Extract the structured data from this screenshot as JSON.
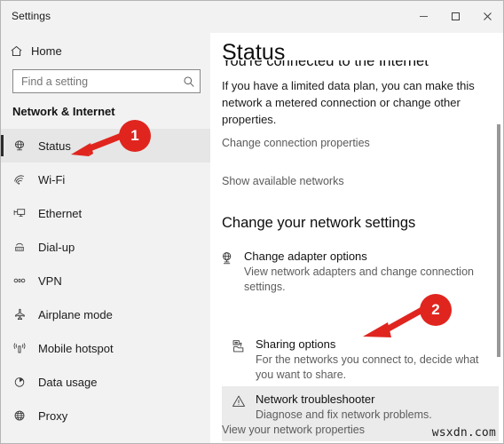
{
  "window": {
    "title": "Settings",
    "controls": {
      "minimize": "minimize-button",
      "maximize": "maximize-button",
      "close": "close-button"
    }
  },
  "sidebar": {
    "home_label": "Home",
    "home_icon": "home-icon",
    "search": {
      "placeholder": "Find a setting",
      "value": "",
      "icon": "search-icon"
    },
    "section_title": "Network & Internet",
    "items": [
      {
        "label": "Status",
        "icon": "status-globe-icon",
        "selected": true
      },
      {
        "label": "Wi-Fi",
        "icon": "wifi-icon",
        "selected": false
      },
      {
        "label": "Ethernet",
        "icon": "ethernet-icon",
        "selected": false
      },
      {
        "label": "Dial-up",
        "icon": "dialup-icon",
        "selected": false
      },
      {
        "label": "VPN",
        "icon": "vpn-icon",
        "selected": false
      },
      {
        "label": "Airplane mode",
        "icon": "airplane-icon",
        "selected": false
      },
      {
        "label": "Mobile hotspot",
        "icon": "hotspot-icon",
        "selected": false
      },
      {
        "label": "Data usage",
        "icon": "data-usage-pie-icon",
        "selected": false
      },
      {
        "label": "Proxy",
        "icon": "proxy-globe-icon",
        "selected": false
      }
    ]
  },
  "content": {
    "page_title": "Status",
    "clipped_heading": "You're connected to the Internet",
    "paragraph": "If you have a limited data plan, you can make this network a metered connection or change other properties.",
    "link_change_connection": "Change connection properties",
    "link_show_networks": "Show available networks",
    "group_heading": "Change your network settings",
    "options": [
      {
        "title": "Change adapter options",
        "subtitle": "View network adapters and change connection settings.",
        "icon": "network-adapter-icon",
        "highlighted": false
      },
      {
        "title": "Sharing options",
        "subtitle": "For the networks you connect to, decide what you want to share.",
        "icon": "sharing-folder-icon",
        "highlighted": true
      },
      {
        "title": "Network troubleshooter",
        "subtitle": "Diagnose and fix network problems.",
        "icon": "warning-triangle-icon",
        "highlighted": false
      }
    ],
    "link_view_properties": "View your network properties"
  },
  "annotations": {
    "color": "#e0251f",
    "badges": [
      {
        "number": "1",
        "points_to": "Status"
      },
      {
        "number": "2",
        "points_to": "Sharing options"
      }
    ]
  },
  "watermark": "wsxdn.com",
  "colors": {
    "sidebar_bg": "#f2f2f2",
    "content_bg": "#ffffff",
    "selected_bg": "#e6e6e6",
    "hover_bg": "#ebebeb",
    "accent_bar": "#2b2b2b",
    "annotation_red": "#e0251f",
    "link_text": "#5a5a5a"
  }
}
